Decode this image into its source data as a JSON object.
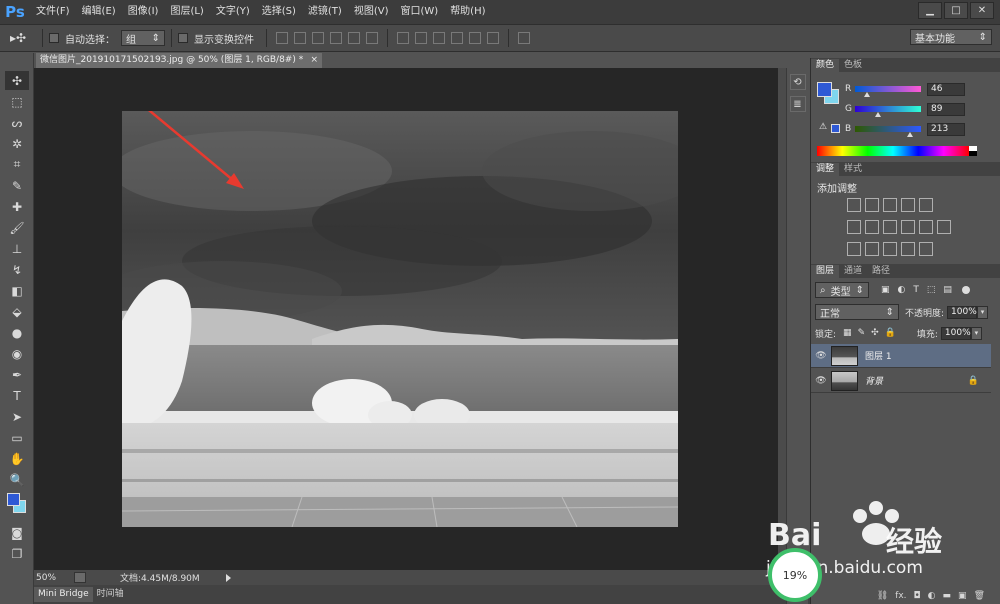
{
  "app": {
    "logo": "Ps",
    "menu": [
      "文件(F)",
      "编辑(E)",
      "图像(I)",
      "图层(L)",
      "文字(Y)",
      "选择(S)",
      "滤镜(T)",
      "视图(V)",
      "窗口(W)",
      "帮助(H)"
    ],
    "window_controls": [
      "▁",
      "□",
      "✕"
    ]
  },
  "options_bar": {
    "auto_select_label": "自动选择：",
    "auto_select_value": "组",
    "show_transform_label": "显示变换控件",
    "workspace": "基本功能"
  },
  "document": {
    "tab_title": "微信图片_20191017150219З.jpg @ 50% (图层 1, RGB/8#) *",
    "tab_close": "×"
  },
  "status": {
    "zoom": "50%",
    "doc_info": "文档:4.45M/8.90M"
  },
  "bottom_tabs": [
    "Mini Bridge",
    "时间轴"
  ],
  "color_panel": {
    "tabs": [
      "颜色",
      "色板"
    ],
    "r_label": "R",
    "g_label": "G",
    "b_label": "B",
    "r": "46",
    "g": "89",
    "b": "213",
    "r_frac": 0.18,
    "g_frac": 0.35,
    "b_frac": 0.84,
    "fg_color": "#2e59d5",
    "bg_color": "#7fd6ee"
  },
  "adjust_panel": {
    "tabs": [
      "调整",
      "样式"
    ],
    "title": "添加调整"
  },
  "layers_panel": {
    "tabs": [
      "图层",
      "通道",
      "路径"
    ],
    "filter": "类型",
    "blend_mode": "正常",
    "opacity_label": "不透明度:",
    "opacity": "100%",
    "lock_label": "锁定:",
    "fill_label": "填充:",
    "fill": "100%",
    "layers": [
      {
        "name": "图层 1",
        "selected": true
      },
      {
        "name": "背景",
        "selected": false
      }
    ],
    "bottom_icons": [
      "⛓",
      "fx.",
      "◘",
      "◐",
      "▬",
      "▣",
      "🗑"
    ]
  },
  "watermark": {
    "brand": "Bai",
    "brand2": "经验",
    "url": "jingyan.baidu.com",
    "badge": "19%"
  }
}
